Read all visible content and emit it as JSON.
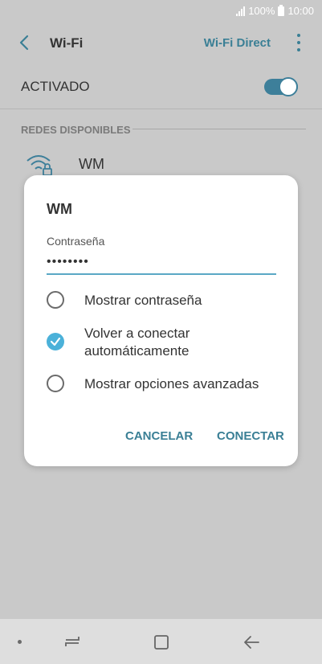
{
  "status_bar": {
    "battery": "100%",
    "time": "10:00"
  },
  "appbar": {
    "title": "Wi-Fi",
    "wifi_direct": "Wi-Fi Direct"
  },
  "activado": {
    "label": "ACTIVADO",
    "on": true
  },
  "section": {
    "label": "REDES DISPONIBLES"
  },
  "network": {
    "name": "WM"
  },
  "dialog": {
    "title": "WM",
    "password_label": "Contraseña",
    "password_value": "••••••••",
    "options": [
      {
        "label": "Mostrar contraseña",
        "checked": false
      },
      {
        "label_line1": "Volver a conectar",
        "label_line2": "automáticamente",
        "checked": true
      },
      {
        "label": "Mostrar opciones avanzadas",
        "checked": false
      }
    ],
    "cancel": "CANCELAR",
    "connect": "CONECTAR"
  },
  "colors": {
    "accent": "#3a7f95",
    "check": "#4bb1d9",
    "input_line": "#5aa8c5",
    "scrim": "#c9c9c9"
  }
}
